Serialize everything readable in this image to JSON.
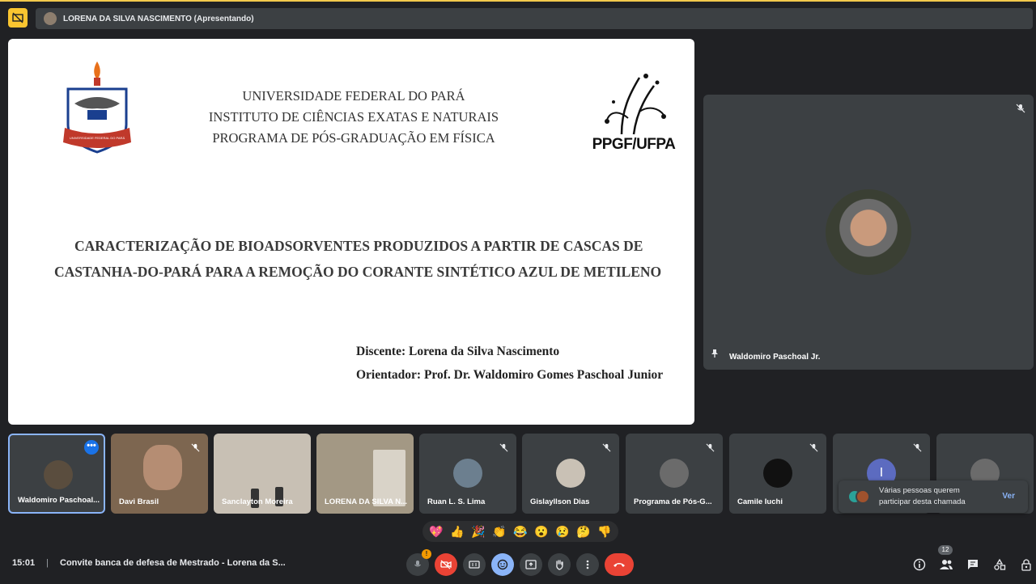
{
  "presenting": {
    "label": "LORENA DA SILVA NASCIMENTO (Apresentando)"
  },
  "slide": {
    "institution_lines": [
      "UNIVERSIDADE FEDERAL DO PARÁ",
      "INSTITUTO DE CIÊNCIAS EXATAS E NATURAIS",
      "PROGRAMA DE PÓS-GRADUAÇÃO EM FÍSICA"
    ],
    "ufpa_seal_text": "UNIVERSIDADE FEDERAL DO PARÁ",
    "ppgf_logo_text": "PPGF/UFPA",
    "title_line1": "CARACTERIZAÇÃO DE BIOADSORVENTES PRODUZIDOS A PARTIR DE CASCAS DE",
    "title_line2": "CASTANHA-DO-PARÁ PARA A REMOÇÃO DO CORANTE  SINTÉTICO AZUL DE METILENO",
    "student": "Discente: Lorena da Silva Nascimento",
    "advisor": "Orientador: Prof. Dr. Waldomiro Gomes Paschoal Junior"
  },
  "featured": {
    "name": "Waldomiro Paschoal Jr."
  },
  "participants": [
    {
      "name": "Waldomiro Paschoal...",
      "color": "#5a4d3e"
    },
    {
      "name": "Davi Brasil",
      "color": "#7a5a3a"
    },
    {
      "name": "Sanclayton Moreira",
      "color": "#b9b0a2"
    },
    {
      "name": "LORENA DA SILVA N...",
      "color": "#9a8f7e"
    },
    {
      "name": "Ruan L. S. Lima",
      "color": "#6c7f8f"
    },
    {
      "name": "Gislayllson Dias",
      "color": "#c9c1b5"
    },
    {
      "name": "Programa de Pós-G...",
      "color": "#6b6b6b"
    },
    {
      "name": "Camile Iuchi",
      "color": "#111111"
    },
    {
      "name": "",
      "color": "#5c6bc0"
    },
    {
      "name": "",
      "color": "#6b6b6b"
    }
  ],
  "ninth_avatar_initial": "I",
  "toast": {
    "line1": "Várias pessoas querem",
    "line2": "participar desta chamada",
    "action": "Ver"
  },
  "reactions": [
    "💖",
    "👍",
    "🎉",
    "👏",
    "😂",
    "😮",
    "😢",
    "🤔",
    "👎"
  ],
  "footer": {
    "time": "15:01",
    "separator": "|",
    "meeting_title": "Convite banca de defesa de Mestrado - Lorena da S..."
  },
  "people_count": "12",
  "icons": [
    "present-to-all-icon",
    "mic-off-icon",
    "camera-off-icon",
    "captions-icon",
    "emoji-icon",
    "present-icon",
    "raise-hand-icon",
    "more-options-icon",
    "hang-up-icon",
    "info-icon",
    "people-icon",
    "chat-icon",
    "activities-icon",
    "host-controls-icon",
    "pin-icon"
  ]
}
